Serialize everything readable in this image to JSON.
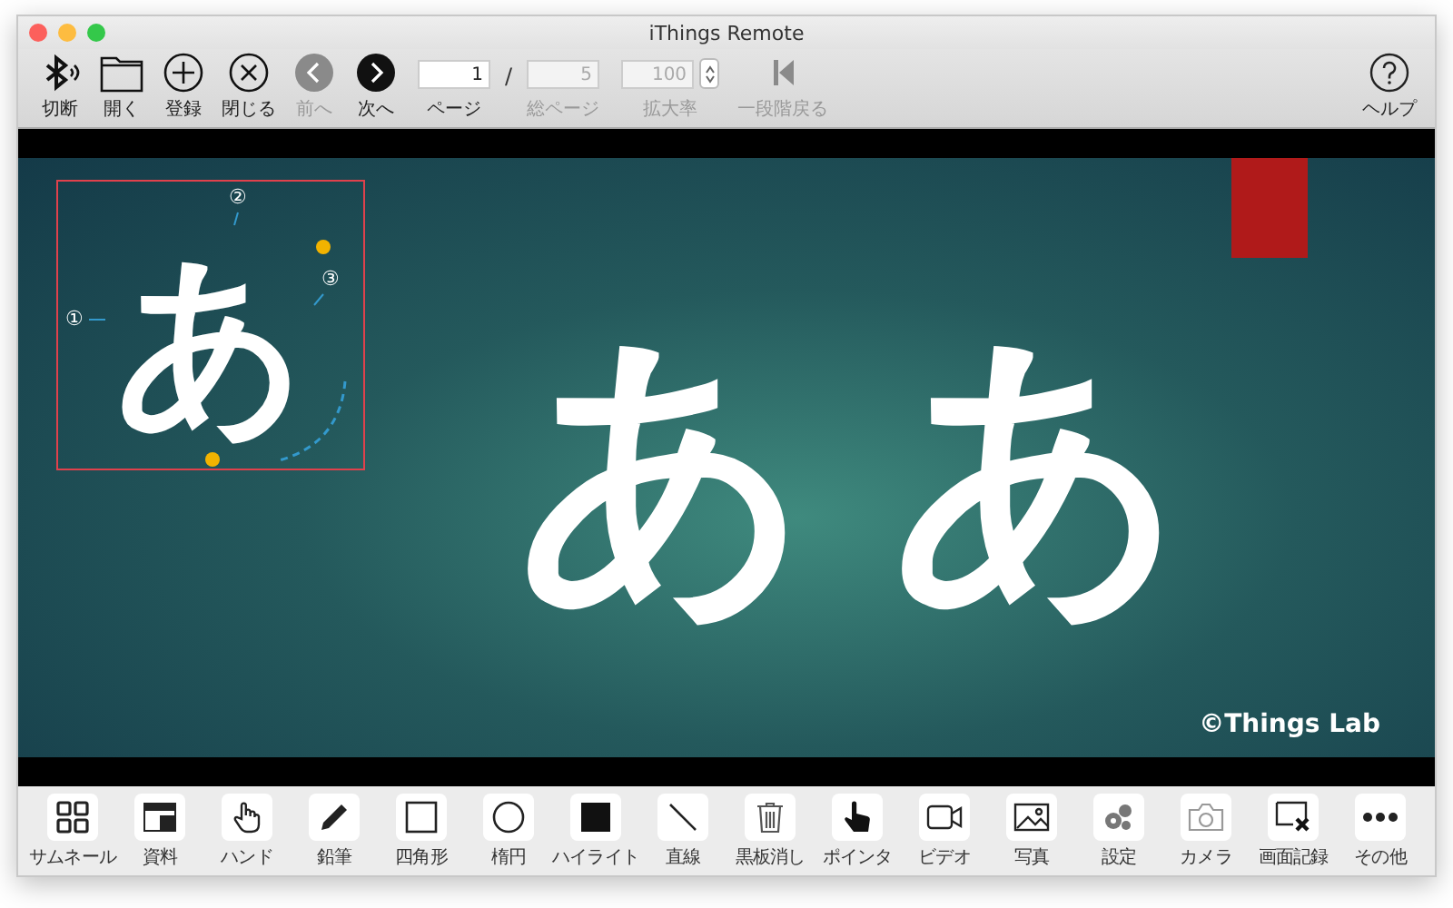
{
  "window": {
    "title": "iThings Remote"
  },
  "toolbar": {
    "items": [
      {
        "kind": "button",
        "label": "切断",
        "disabled": false
      },
      {
        "kind": "button",
        "label": "開く",
        "disabled": false
      },
      {
        "kind": "button",
        "label": "登録",
        "disabled": false
      },
      {
        "kind": "button",
        "label": "閉じる",
        "disabled": false
      },
      {
        "kind": "button",
        "label": "前へ",
        "disabled": true
      },
      {
        "kind": "button",
        "label": "次へ",
        "disabled": false
      },
      {
        "kind": "field",
        "value": "1",
        "label": "ページ",
        "disabled": false
      },
      {
        "kind": "separator",
        "text": "/"
      },
      {
        "kind": "field",
        "value": "5",
        "label": "総ページ",
        "disabled": true
      },
      {
        "kind": "stepper",
        "value": "100",
        "label": "拡大率",
        "disabled": true
      },
      {
        "kind": "button",
        "label": "一段階戻る",
        "disabled": true
      }
    ],
    "help": {
      "label": "ヘルプ"
    }
  },
  "slide": {
    "example_char": "あ",
    "callouts": [
      "①",
      "②",
      "③"
    ],
    "large_chars": [
      "あ",
      "あ"
    ],
    "credit": "©Things Lab"
  },
  "tools": [
    {
      "label": "サムネール"
    },
    {
      "label": "資料"
    },
    {
      "label": "ハンド"
    },
    {
      "label": "鉛筆"
    },
    {
      "label": "四角形"
    },
    {
      "label": "楕円"
    },
    {
      "label": "ハイライト"
    },
    {
      "label": "直線"
    },
    {
      "label": "黒板消し"
    },
    {
      "label": "ポインタ"
    },
    {
      "label": "ビデオ"
    },
    {
      "label": "写真"
    },
    {
      "label": "設定"
    },
    {
      "label": "カメラ"
    },
    {
      "label": "画面記録"
    },
    {
      "label": "その他"
    }
  ]
}
